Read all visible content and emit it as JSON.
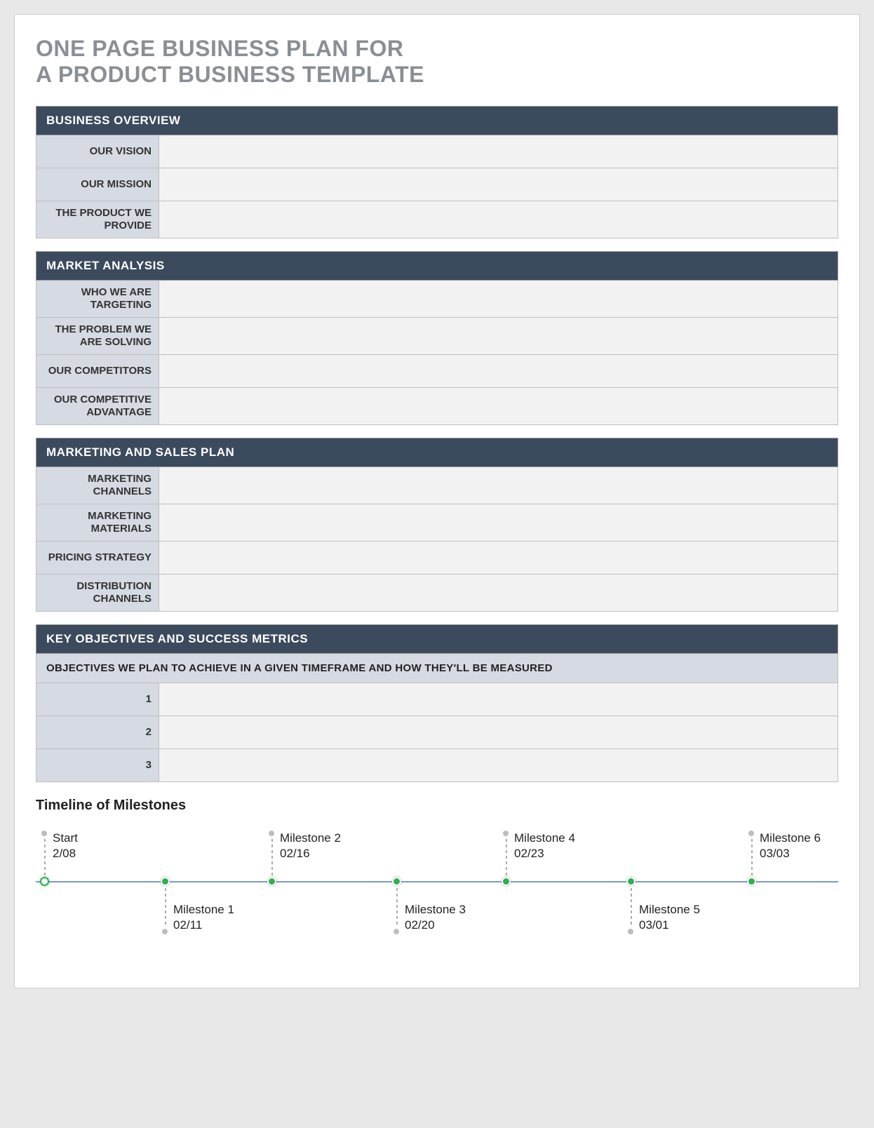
{
  "title_line1": "ONE PAGE BUSINESS PLAN FOR",
  "title_line2": "A PRODUCT BUSINESS TEMPLATE",
  "sections": {
    "overview": {
      "header": "BUSINESS OVERVIEW",
      "rows": {
        "vision_label": "OUR VISION",
        "vision_value": "",
        "mission_label": "OUR MISSION",
        "mission_value": "",
        "product_label": "THE PRODUCT WE PROVIDE",
        "product_value": ""
      }
    },
    "market": {
      "header": "MARKET ANALYSIS",
      "rows": {
        "targeting_label": "WHO WE ARE TARGETING",
        "targeting_value": "",
        "problem_label": "THE PROBLEM WE ARE SOLVING",
        "problem_value": "",
        "competitors_label": "OUR COMPETITORS",
        "competitors_value": "",
        "advantage_label": "OUR COMPETITIVE ADVANTAGE",
        "advantage_value": ""
      }
    },
    "marketing": {
      "header": "MARKETING AND SALES PLAN",
      "rows": {
        "channels_label": "MARKETING CHANNELS",
        "channels_value": "",
        "materials_label": "MARKETING MATERIALS",
        "materials_value": "",
        "pricing_label": "PRICING STRATEGY",
        "pricing_value": "",
        "distribution_label": "DISTRIBUTION CHANNELS",
        "distribution_value": ""
      }
    },
    "objectives": {
      "header": "KEY OBJECTIVES AND SUCCESS METRICS",
      "subheader": "OBJECTIVES WE PLAN TO ACHIEVE IN A GIVEN TIMEFRAME AND HOW THEY'LL BE MEASURED",
      "rows": {
        "r1_label": "1",
        "r1_value": "",
        "r2_label": "2",
        "r2_value": "",
        "r3_label": "3",
        "r3_value": ""
      }
    }
  },
  "timeline": {
    "title": "Timeline of Milestones",
    "milestones": {
      "m0_label": "Start",
      "m0_date": "2/08",
      "m1_label": "Milestone 1",
      "m1_date": "02/11",
      "m2_label": "Milestone 2",
      "m2_date": "02/16",
      "m3_label": "Milestone 3",
      "m3_date": "02/20",
      "m4_label": "Milestone 4",
      "m4_date": "02/23",
      "m5_label": "Milestone 5",
      "m5_date": "03/01",
      "m6_label": "Milestone 6",
      "m6_date": "03/03"
    }
  }
}
